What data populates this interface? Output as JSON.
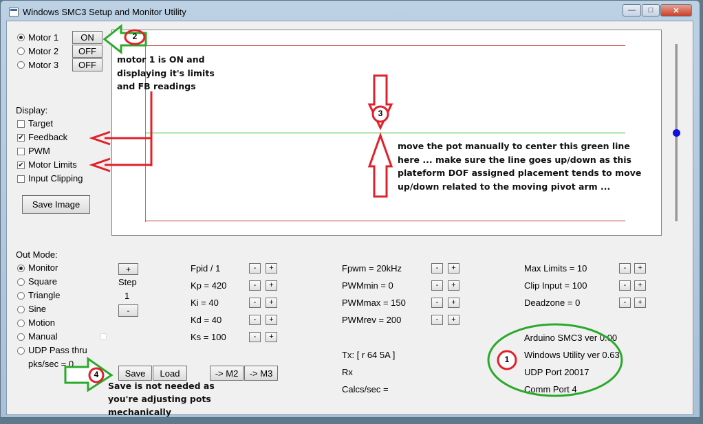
{
  "window": {
    "title": "Windows SMC3 Setup and Monitor Utility",
    "minimize_glyph": "—",
    "maximize_glyph": "□",
    "close_glyph": "✕"
  },
  "motors": [
    {
      "label": "Motor 1",
      "button": "ON",
      "selected": true
    },
    {
      "label": "Motor 2",
      "button": "OFF",
      "selected": false
    },
    {
      "label": "Motor 3",
      "button": "OFF",
      "selected": false
    }
  ],
  "display": {
    "heading": "Display:",
    "options": [
      {
        "label": "Target",
        "checked": false
      },
      {
        "label": "Feedback",
        "checked": true
      },
      {
        "label": "PWM",
        "checked": false
      },
      {
        "label": "Motor Limits",
        "checked": true
      },
      {
        "label": "Input Clipping",
        "checked": false
      }
    ],
    "save_image": "Save Image",
    "check_glyph": "✔"
  },
  "out_mode": {
    "heading": "Out Mode:",
    "options": [
      {
        "label": "Monitor",
        "selected": true
      },
      {
        "label": "Square",
        "selected": false
      },
      {
        "label": "Triangle",
        "selected": false
      },
      {
        "label": "Sine",
        "selected": false
      },
      {
        "label": "Motion",
        "selected": false
      },
      {
        "label": "Manual",
        "selected": false
      },
      {
        "label": "UDP Pass thru",
        "selected": false
      }
    ],
    "pks_label": "pks/sec = 0"
  },
  "step": {
    "plus": "+",
    "label": "Step",
    "value": "1",
    "minus": "-"
  },
  "pid": [
    {
      "label": "Fpid / 1"
    },
    {
      "label": "Kp = 420"
    },
    {
      "label": "Ki = 40"
    },
    {
      "label": "Kd = 40"
    },
    {
      "label": "Ks = 100"
    }
  ],
  "pwm": [
    {
      "label": "Fpwm = 20kHz"
    },
    {
      "label": "PWMmin = 0"
    },
    {
      "label": "PWMmax = 150"
    },
    {
      "label": "PWMrev = 200"
    }
  ],
  "limits": [
    {
      "label": "Max Limits = 10"
    },
    {
      "label": "Clip Input = 100"
    },
    {
      "label": "Deadzone = 0"
    }
  ],
  "pm": {
    "minus": "-",
    "plus": "+"
  },
  "comm": {
    "tx": "Tx: [ r 64 5A ]",
    "rx": "Rx",
    "calcs": "Calcs/sec =",
    "arduino": "Arduino SMC3 ver 0.00",
    "windows": "Windows Utility ver 0.63",
    "udp": "UDP Port 20017",
    "port": "Comm Port 4"
  },
  "actions": {
    "save": "Save",
    "load": "Load",
    "to_m2": "-> M2",
    "to_m3": "-> M3"
  },
  "slider": {
    "level": 0.5
  },
  "annotations": {
    "note_motor": [
      "motor 1 is ON and",
      "displaying it's limits",
      "and FB readings"
    ],
    "note_pot": [
      "move the pot manually to center this green line",
      "here ... make sure the line goes up/down as this",
      "plateform DOF assigned placement tends to move",
      "up/down related to the moving pivot arm ..."
    ],
    "note_save": [
      "Save is not needed as",
      "you're adjusting pots",
      "mechanically"
    ],
    "badge_1": "1",
    "badge_2": "2",
    "badge_3": "3",
    "badge_4": "4"
  },
  "colors": {
    "limit_line": "#c0392b",
    "feedback_line": "#22bb22",
    "annotation_red": "#e0202a",
    "annotation_green": "#2aaa2a",
    "slider_thumb": "#1010e0"
  }
}
